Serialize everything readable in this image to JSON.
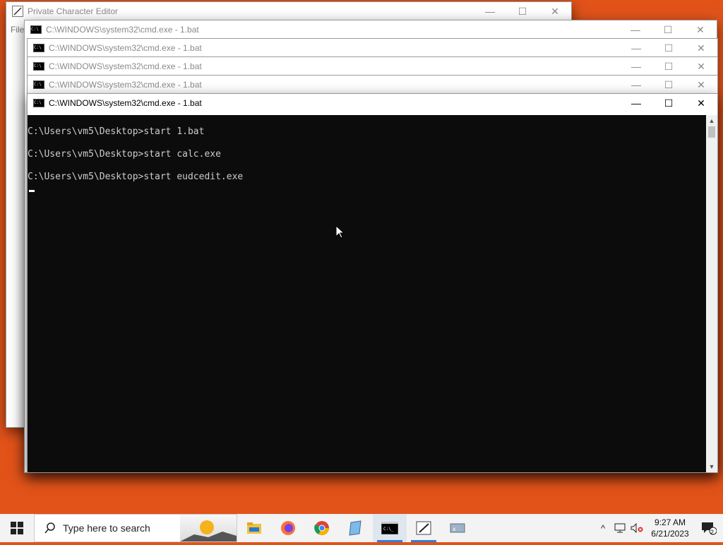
{
  "private_editor": {
    "title": "Private Character Editor",
    "menu_file": "File"
  },
  "cmd_windows": [
    {
      "title": "C:\\WINDOWS\\system32\\cmd.exe - 1.bat"
    },
    {
      "title": "C:\\WINDOWS\\system32\\cmd.exe - 1.bat"
    },
    {
      "title": "C:\\WINDOWS\\system32\\cmd.exe - 1.bat"
    },
    {
      "title": "C:\\WINDOWS\\system32\\cmd.exe - 1.bat"
    }
  ],
  "active_window": {
    "title": "C:\\WINDOWS\\system32\\cmd.exe - 1.bat",
    "icon_text": "C:\\_",
    "lines": [
      "C:\\Users\\vm5\\Desktop>start 1.bat",
      "C:\\Users\\vm5\\Desktop>start calc.exe",
      "C:\\Users\\vm5\\Desktop>start eudcedit.exe"
    ]
  },
  "window_controls": {
    "minimize": "—",
    "maximize": "☐",
    "close": "✕"
  },
  "taskbar": {
    "search_placeholder": "Type here to search",
    "icons": [
      "windows-start-icon",
      "search-icon",
      "file-explorer-icon",
      "firefox-icon",
      "chrome-icon",
      "notepad-icon",
      "cmd-icon",
      "private-character-editor-icon",
      "generic-app-icon"
    ],
    "tray_chevron": "^",
    "time": "9:27 AM",
    "date": "6/21/2023",
    "notification_count": "2"
  }
}
